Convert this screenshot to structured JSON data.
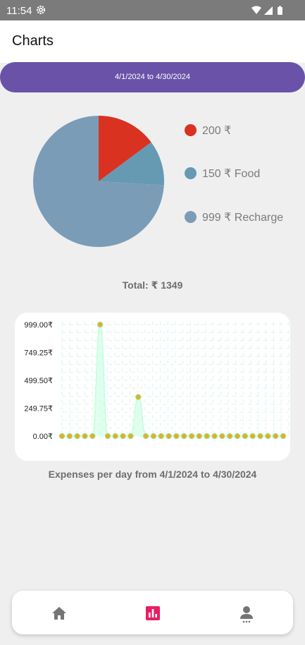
{
  "status_bar": {
    "time": "11:54",
    "icons": [
      "settings-gear-icon",
      "wifi-icon",
      "cell-signal-icon",
      "battery-icon"
    ]
  },
  "app_bar": {
    "title": "Charts"
  },
  "date_range": {
    "label": "4/1/2024 to 4/30/2024"
  },
  "pie": {
    "legend": [
      {
        "text": "200 ₹",
        "value": 200,
        "color": "#d93220"
      },
      {
        "text": "150 ₹ Food",
        "value": 150,
        "color": "#6699b2"
      },
      {
        "text": "999 ₹ Recharge",
        "value": 999,
        "color": "#7b9cb7"
      }
    ]
  },
  "total": {
    "label": "Total: ₹ 1349"
  },
  "chart_data": [
    {
      "type": "pie",
      "categories": [
        "",
        "Food",
        "Recharge"
      ],
      "values": [
        200,
        150,
        999
      ],
      "colors": [
        "#d93220",
        "#6699b2",
        "#7b9cb7"
      ],
      "legend_labels": [
        "200 ₹",
        "150 ₹ Food",
        "999 ₹ Recharge"
      ],
      "legend_position": "right"
    },
    {
      "type": "line",
      "x": [
        1,
        2,
        3,
        4,
        5,
        6,
        7,
        8,
        9,
        10,
        11,
        12,
        13,
        14,
        15,
        16,
        17,
        18,
        19,
        20,
        21,
        22,
        23,
        24,
        25,
        26,
        27,
        28,
        29,
        30
      ],
      "values": [
        0,
        0,
        0,
        0,
        0,
        999,
        0,
        0,
        0,
        0,
        350,
        0,
        0,
        0,
        0,
        0,
        0,
        0,
        0,
        0,
        0,
        0,
        0,
        0,
        0,
        0,
        0,
        0,
        0,
        0
      ],
      "y_ticks": [
        "999.00₹",
        "749.25₹",
        "499.50₹",
        "249.75₹",
        "0.00₹"
      ],
      "ylim": [
        0,
        999
      ],
      "grid": true,
      "line_color": "#c8ffe0",
      "point_color": "#f7a12b",
      "point_stroke": "#9ddb6a"
    }
  ],
  "line_chart": {
    "caption": "Expenses per day from 4/1/2024 to 4/30/2024"
  },
  "bottom_nav": {
    "items": [
      {
        "name": "home",
        "icon": "home-icon",
        "active": false
      },
      {
        "name": "charts",
        "icon": "bar-chart-icon",
        "active": true
      },
      {
        "name": "profile",
        "icon": "account-icon",
        "active": false
      }
    ],
    "active_color": "#e91e63",
    "inactive_color": "#757575"
  }
}
